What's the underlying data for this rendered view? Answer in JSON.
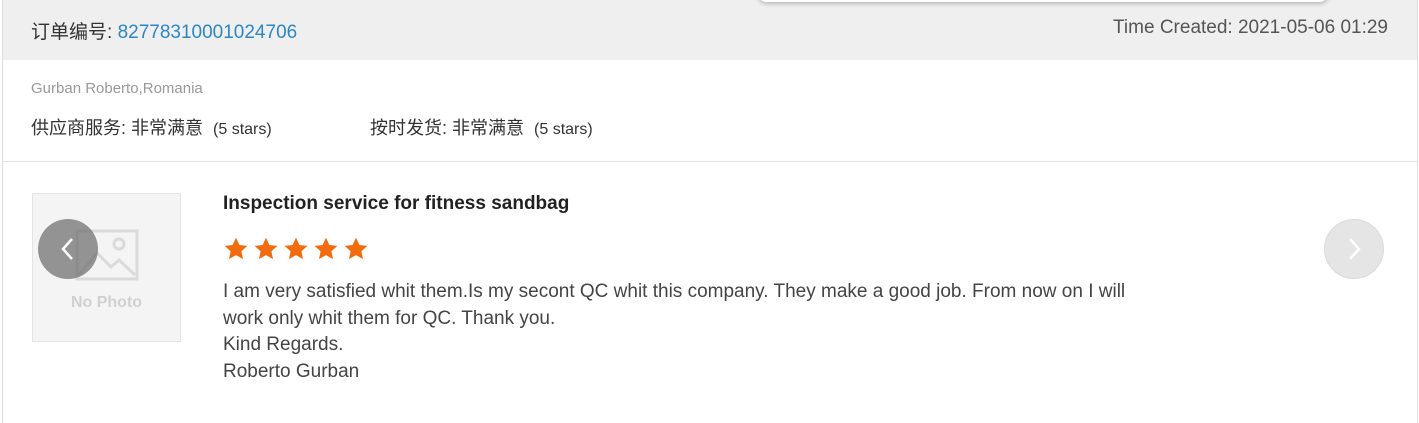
{
  "header": {
    "order_label": "订单编号: ",
    "order_number": "82778310001024706",
    "time_created": "Time Created: 2021-05-06 01:29"
  },
  "review": {
    "buyer": "Gurban Roberto,Romania",
    "ratings": [
      {
        "label": "供应商服务: 非常满意",
        "note": "(5 stars)"
      },
      {
        "label": "按时发货: 非常满意",
        "note": "(5 stars)"
      }
    ],
    "photo_placeholder": "No Photo",
    "product_title": "Inspection service for fitness sandbag",
    "star_count": 5,
    "star_color": "#f26b0f",
    "body_lines": [
      "I am very satisfied whit them.Is my secont QC whit this company. They make a good job. From now on I will",
      "work only whit them for QC. Thank you.",
      "Kind Regards.",
      "Roberto Gurban"
    ]
  },
  "navigation": {
    "prev_icon": "chevron-left-icon",
    "next_icon": "chevron-right-icon"
  },
  "colors": {
    "header_bg": "#efefef",
    "order_number": "#2a87c8"
  }
}
